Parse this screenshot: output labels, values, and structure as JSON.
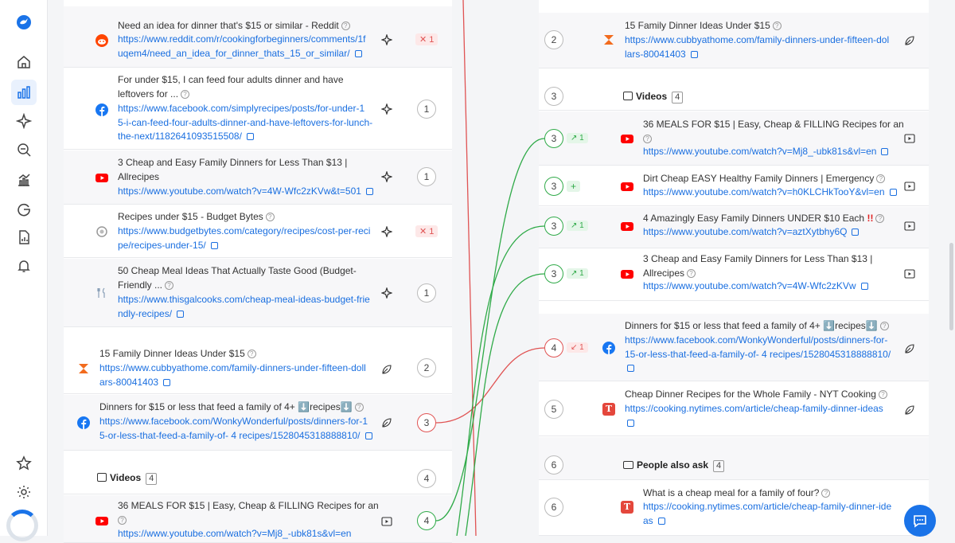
{
  "sidebar": {
    "items": [
      "logo-icon",
      "home-icon",
      "analytics-icon",
      "sparkle-icon",
      "search-rank-icon",
      "chart-icon",
      "google-icon",
      "report-icon",
      "bell-icon",
      "star-icon",
      "settings-icon"
    ]
  },
  "colors": {
    "link": "#1a6fe0",
    "green": "#2faa48",
    "red": "#e05353"
  },
  "left": {
    "rows": [
      {
        "title": "Need an idea for dinner that's $15 or similar - Reddit",
        "url1": "https://www.reddit.com/r/cookingforbeginners/comments/1f",
        "url2": "uqem4/need_an_idea_for_dinner_thats_15_or_similar/",
        "badge": "✕ 1"
      },
      {
        "title1": "For under $15, I can feed four adults dinner and have",
        "title2": "leftovers for ...",
        "url1": "https://www.facebook.com/simplyrecipes/posts/for-under-1",
        "url2": "5-i-can-feed-four-adults-dinner-and-have-leftovers-for-lunch-",
        "url3": "the-next/1182641093515508/",
        "pos": "1"
      },
      {
        "title1": "3 Cheap and Easy Family Dinners for Less Than $13 |",
        "title2": "Allrecipes",
        "url1": "https://www.youtube.com/watch?v=4W-Wfc2zKVw&t=501",
        "pos": "1"
      },
      {
        "title": "Recipes under $15 - Budget Bytes",
        "url1": "https://www.budgetbytes.com/category/recipes/cost-per-reci",
        "url2": "pe/recipes-under-15/",
        "badge": "✕ 1"
      },
      {
        "title1": "50 Cheap Meal Ideas That Actually Taste Good (Budget-",
        "title2": "Friendly ...",
        "url1": "https://www.thisgalcooks.com/cheap-meal-ideas-budget-frie",
        "url2": "ndly-recipes/",
        "pos": "1"
      },
      {
        "title": "15 Family Dinner Ideas Under $15",
        "url1": "https://www.cubbyathome.com/family-dinners-under-fifteen-doll",
        "url2": "ars-80041403",
        "pos": "2"
      },
      {
        "title": "Dinners for $15 or less that feed a family of 4+ ⬇️recipes⬇️",
        "url1": "https://www.facebook.com/WonkyWonderful/posts/dinners-for-1",
        "url2": "5-or-less-that-feed-a-family-of- 4 recipes/1528045318888810/",
        "pos": "3"
      },
      {
        "section": "Videos",
        "count": "4",
        "pos": "4"
      },
      {
        "title": "36 MEALS FOR $15 | Easy, Cheap & FILLING Recipes for an",
        "url1": "https://www.youtube.com/watch?v=Mj8_-ubk81s&vl=en",
        "pos": "4"
      }
    ]
  },
  "right": {
    "rows": [
      {
        "pos": "2",
        "title": "15 Family Dinner Ideas Under $15",
        "url1": "https://www.cubbyathome.com/family-dinners-under-fifteen-dol",
        "url2": "lars-80041403"
      },
      {
        "pos": "3",
        "section": "Videos",
        "count": "4"
      },
      {
        "pos": "3",
        "badge": "↗ 1",
        "title": "36 MEALS FOR $15 | Easy, Cheap & FILLING Recipes for an",
        "url1": "https://www.youtube.com/watch?v=Mj8_-ubk81s&vl=en"
      },
      {
        "pos": "3",
        "badge": "+",
        "title": "Dirt Cheap EASY Healthy Family Dinners | Emergency",
        "url1": "https://www.youtube.com/watch?v=h0KLCHkTooY&vl=en"
      },
      {
        "pos": "3",
        "badge": "↗ 1",
        "title": "4 Amazingly Easy Family Dinners UNDER $10 Each",
        "bang": "!!",
        "url1": "https://www.youtube.com/watch?v=aztXytbhy6Q"
      },
      {
        "pos": "3",
        "badge": "↗ 1",
        "title1": "3 Cheap and Easy Family Dinners for Less Than $13 |",
        "title2": "Allrecipes",
        "url1": "https://www.youtube.com/watch?v=4W-Wfc2zKVw"
      },
      {
        "pos": "4",
        "badge": "↙ 1",
        "title": "Dinners for $15 or less that feed a family of 4+ ⬇️recipes⬇️",
        "url1": "https://www.facebook.com/WonkyWonderful/posts/dinners-for-",
        "url2": "15-or-less-that-feed-a-family-of- 4 recipes/1528045318888810/"
      },
      {
        "pos": "5",
        "title": "Cheap Dinner Recipes for the Whole Family - NYT Cooking",
        "url1": "https://cooking.nytimes.com/article/cheap-family-dinner-ideas"
      },
      {
        "pos": "6",
        "section": "People also ask",
        "count": "4"
      },
      {
        "pos": "6",
        "title": "What is a cheap meal for a family of four?",
        "url1": "https://cooking.nytimes.com/article/cheap-family-dinner-ide",
        "url2": "as"
      }
    ]
  },
  "q": "?"
}
